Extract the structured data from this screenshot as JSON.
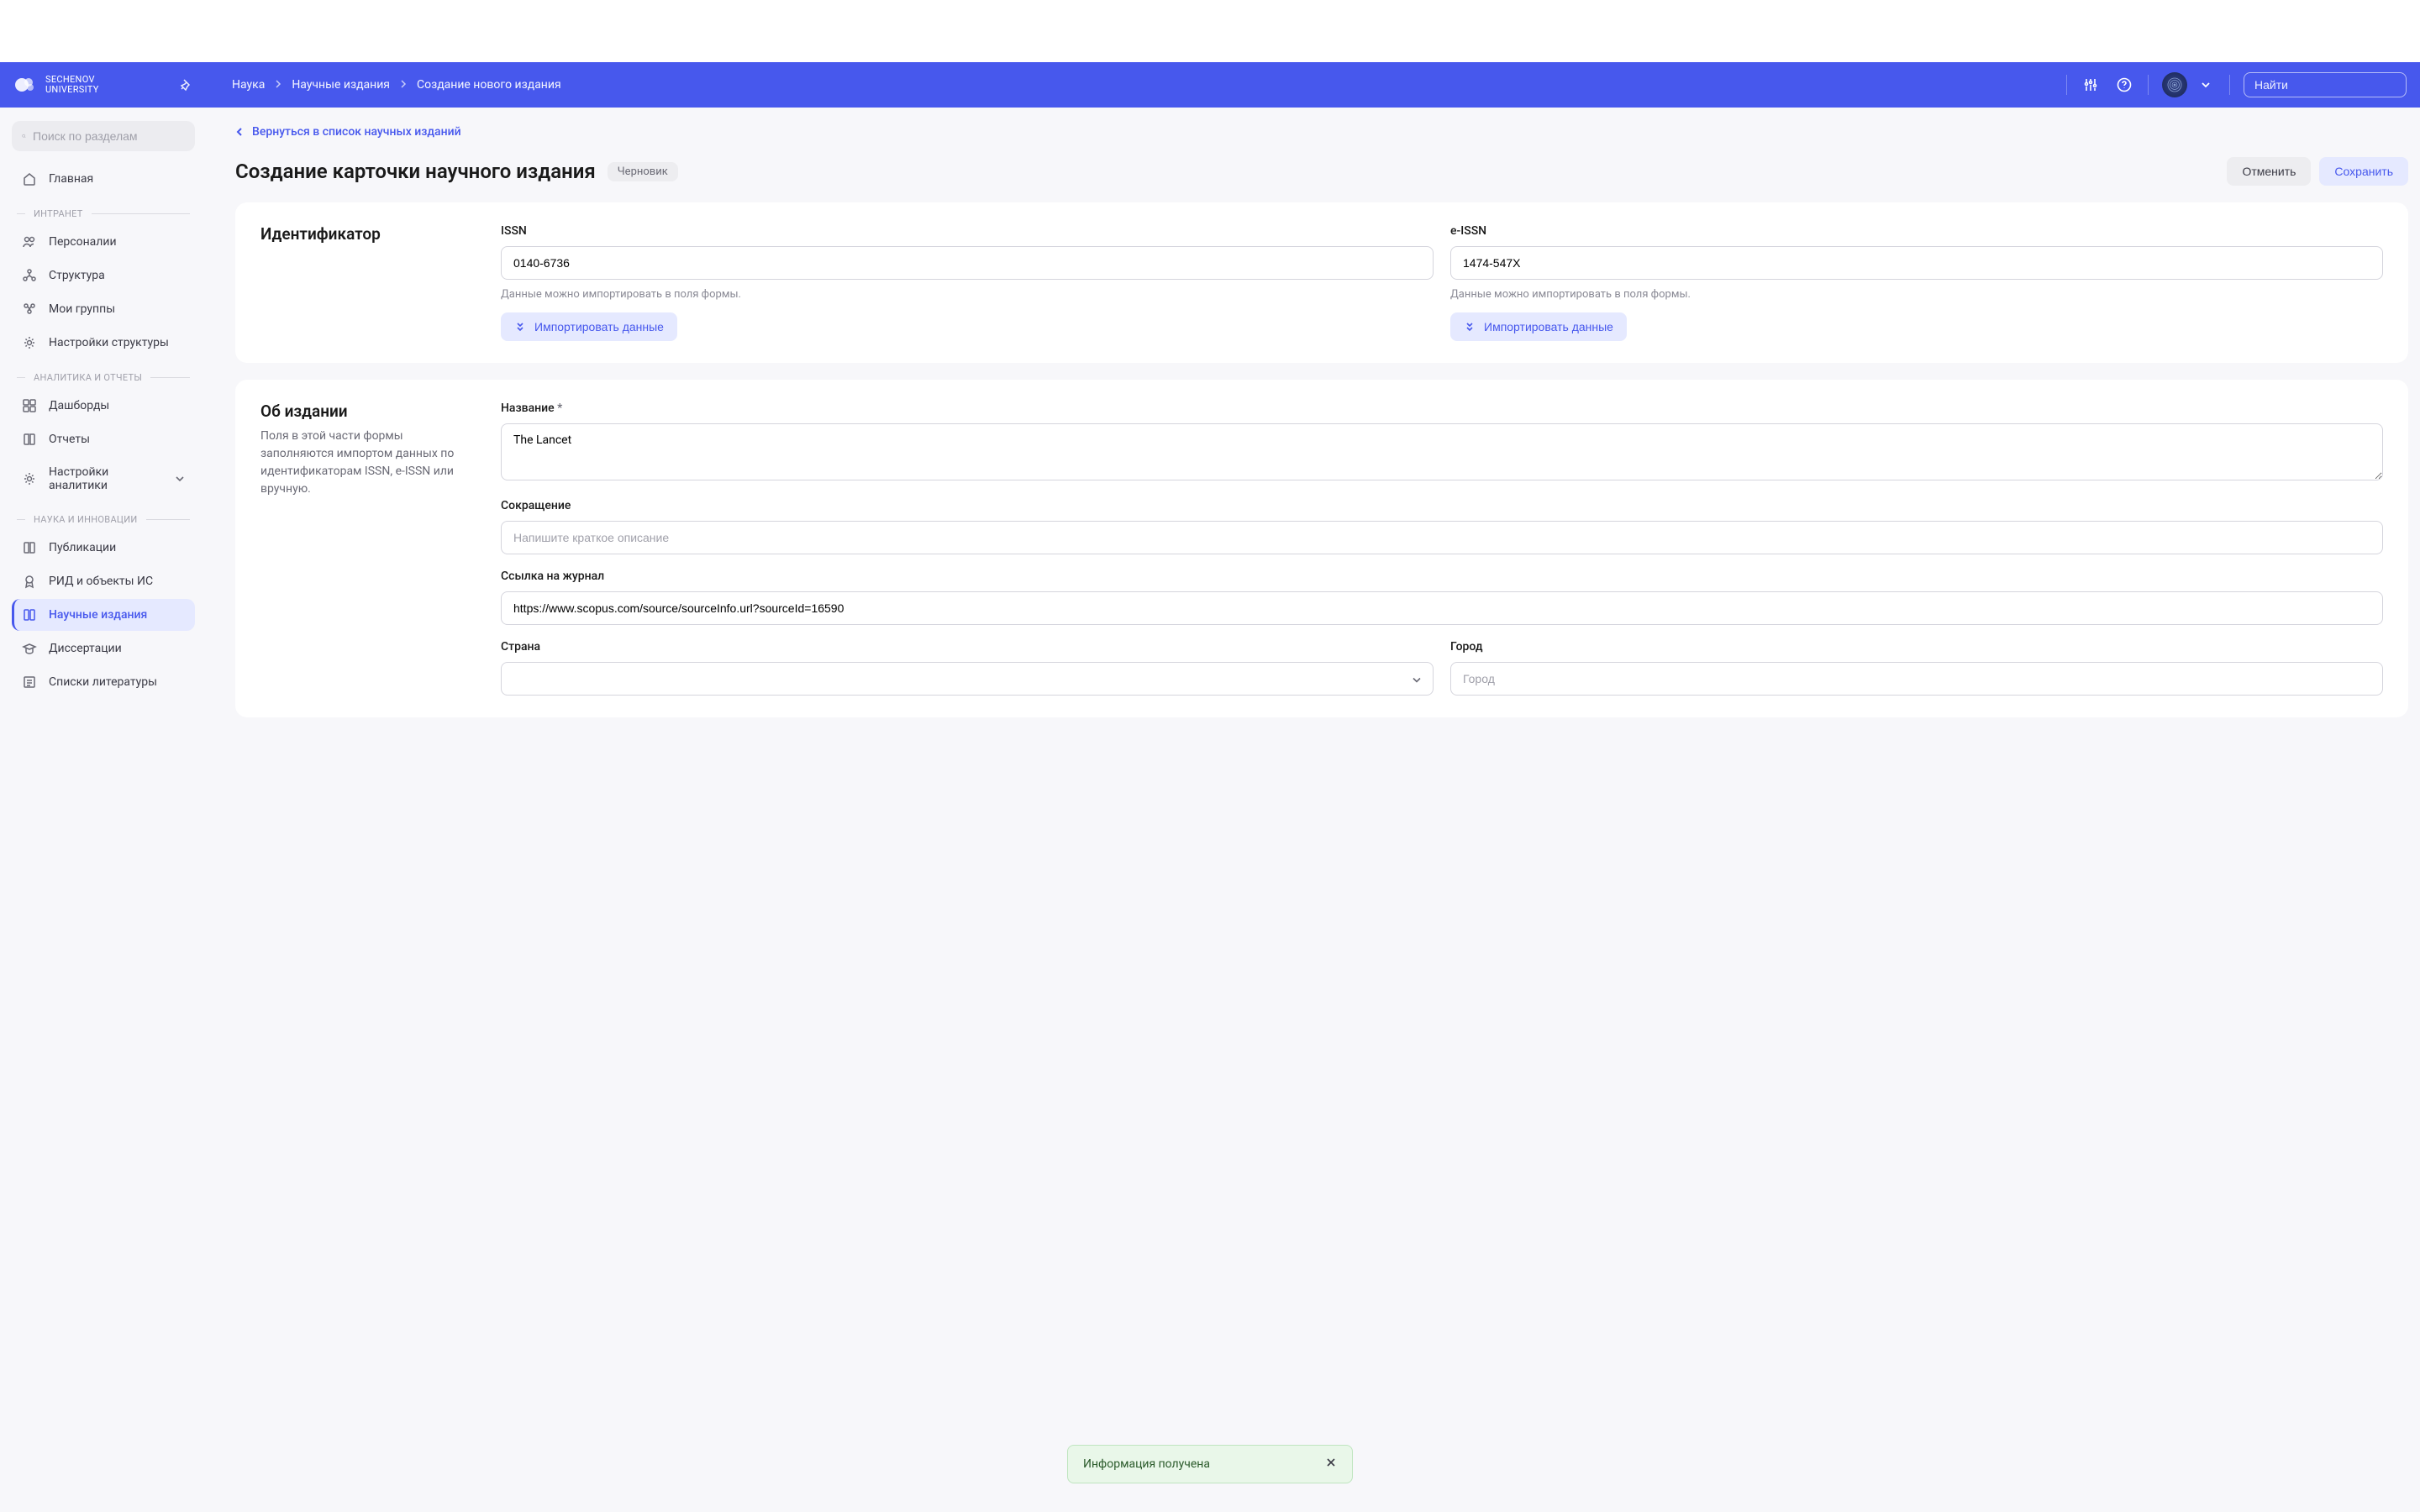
{
  "logo": {
    "line1": "SECHENOV",
    "line2": "UNIVERSITY"
  },
  "breadcrumbs": [
    "Наука",
    "Научные издания",
    "Создание нового издания"
  ],
  "header_search_placeholder": "Найти",
  "sidebar": {
    "search_placeholder": "Поиск по разделам",
    "home": "Главная",
    "sections": {
      "intranet": {
        "label": "ИНТРАНЕТ",
        "items": [
          "Персоналии",
          "Структура",
          "Мои группы",
          "Настройки структуры"
        ]
      },
      "analytics": {
        "label": "АНАЛИТИКА И ОТЧЕТЫ",
        "items": [
          "Дашборды",
          "Отчеты",
          "Настройки аналитики"
        ]
      },
      "science": {
        "label": "НАУКА И ИННОВАЦИИ",
        "items": [
          "Публикации",
          "РИД и объекты ИС",
          "Научные издания",
          "Диссертации",
          "Списки литературы"
        ]
      }
    }
  },
  "back_link": "Вернуться в список научных изданий",
  "page": {
    "title": "Создание карточки научного издания",
    "draft": "Черновик",
    "cancel": "Отменить",
    "save": "Сохранить"
  },
  "identifier": {
    "title": "Идентификатор",
    "issn_label": "ISSN",
    "issn_value": "0140-6736",
    "eissn_label": "e-ISSN",
    "eissn_value": "1474-547X",
    "help": "Данные можно импортировать в поля формы.",
    "import": "Импортировать данные"
  },
  "about": {
    "title": "Об издании",
    "desc": "Поля в этой части формы заполняются импортом данных по идентификаторам ISSN, e-ISSN или вручную.",
    "name_label": "Название",
    "name_value": "The Lancet",
    "abbr_label": "Сокращение",
    "abbr_placeholder": "Напишите краткое описание",
    "link_label": "Ссылка на журнал",
    "link_value": "https://www.scopus.com/source/sourceInfo.url?sourceId=16590",
    "country_label": "Страна",
    "city_label": "Город",
    "city_placeholder": "Город"
  },
  "toast": "Информация получена"
}
